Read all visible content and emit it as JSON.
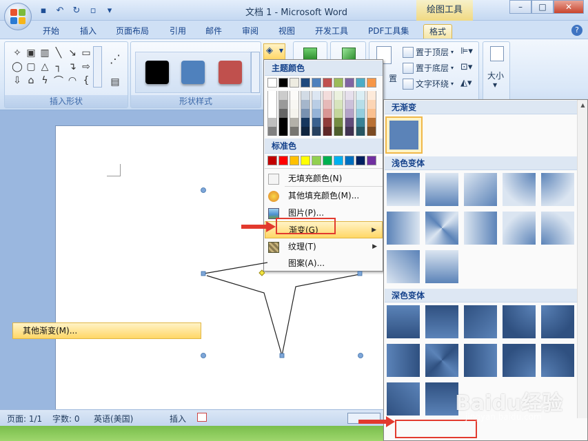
{
  "window": {
    "title": "文档 1 - Microsoft Word",
    "context_tab": "绘图工具",
    "controls": [
      "–",
      "□",
      "✕"
    ]
  },
  "tabs": [
    "开始",
    "插入",
    "页面布局",
    "引用",
    "邮件",
    "审阅",
    "视图",
    "开发工具",
    "PDF工具集",
    "格式"
  ],
  "active_tab": "格式",
  "ribbon": {
    "insert_shapes_label": "插入形状",
    "shape_styles_label": "形状样式",
    "arrange": {
      "bring_front": "置于顶层",
      "send_back": "置于底层",
      "text_wrap": "文字环绕",
      "position_partial": "置"
    },
    "size_label": "大小",
    "style_colors": [
      "#000000",
      "#4f81bd",
      "#c0504d"
    ]
  },
  "fill_menu": {
    "theme_colors_header": "主题颜色",
    "theme_colors": [
      "#ffffff",
      "#000000",
      "#eeece1",
      "#1f497d",
      "#4f81bd",
      "#c0504d",
      "#9bbb59",
      "#8064a2",
      "#4bacc6",
      "#f79646"
    ],
    "standard_colors_header": "标准色",
    "standard_colors": [
      "#c00000",
      "#ff0000",
      "#ffc000",
      "#ffff00",
      "#92d050",
      "#00b050",
      "#00b0f0",
      "#0070c0",
      "#002060",
      "#7030a0"
    ],
    "items": {
      "no_fill": "无填充颜色(N)",
      "more_colors": "其他填充颜色(M)...",
      "picture": "图片(P)...",
      "gradient": "渐变(G)",
      "texture": "纹理(T)",
      "pattern": "图案(A)..."
    }
  },
  "gradient_menu": {
    "no_gradient_header": "无渐变",
    "light_variations_header": "浅色变体",
    "dark_variations_header": "深色变体",
    "more_gradients": "其他渐变(M)...",
    "light_color": "#dbe5f1",
    "dark_color": "#2f5080",
    "mid_color": "#5b83b8"
  },
  "status_bar": {
    "page": "页面: 1/1",
    "words": "字数: 0",
    "language": "英语(美国)",
    "mode": "插入"
  },
  "watermark": {
    "text": "Baidu经验",
    "sub": "jingyan.baidu.com"
  }
}
